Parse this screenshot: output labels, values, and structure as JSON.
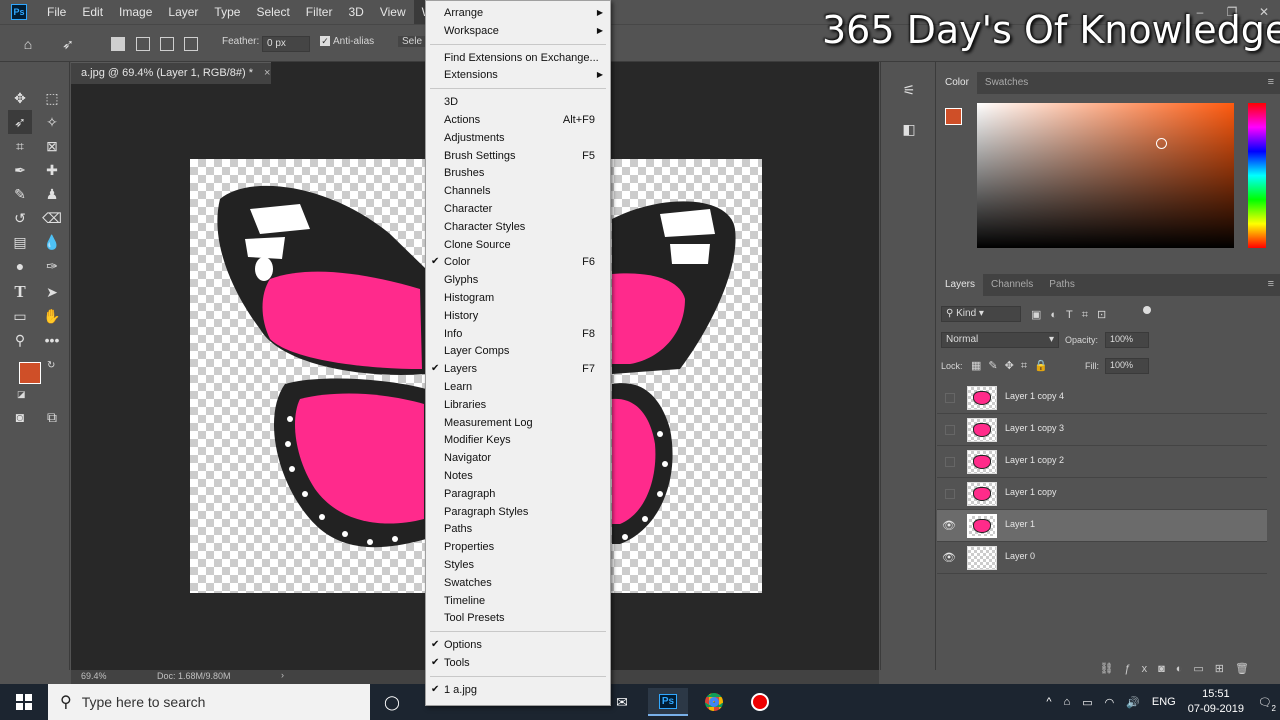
{
  "menubar": {
    "app_icon": "Ps",
    "items": [
      "File",
      "Edit",
      "Image",
      "Layer",
      "Type",
      "Select",
      "Filter",
      "3D",
      "View",
      "Window"
    ],
    "active": "Window"
  },
  "options": {
    "feather_label": "Feather:",
    "feather_value": "0 px",
    "antialias_label": "Anti-alias",
    "antialias_checked": true,
    "select_mask": "Sele"
  },
  "document": {
    "tab_title": "a.jpg @ 69.4% (Layer 1, RGB/8#) *",
    "close": "×",
    "zoom": "69.4%",
    "doc_size": "Doc: 1.68M/9.80M"
  },
  "colors": {
    "foreground": "#cf4f28",
    "background": "#ffffff"
  },
  "color_panel": {
    "tabs": [
      "Color",
      "Swatches"
    ],
    "active_tab": "Color"
  },
  "layers_panel": {
    "tabs": [
      "Layers",
      "Channels",
      "Paths"
    ],
    "active_tab": "Layers",
    "filter_kind": "Kind",
    "blend_mode": "Normal",
    "opacity_label": "Opacity:",
    "opacity": "100%",
    "lock_label": "Lock:",
    "fill_label": "Fill:",
    "fill": "100%",
    "layers": [
      {
        "name": "Layer 1 copy 4",
        "visible": false,
        "selected": false,
        "has_art": true
      },
      {
        "name": "Layer 1 copy 3",
        "visible": false,
        "selected": false,
        "has_art": true
      },
      {
        "name": "Layer 1 copy 2",
        "visible": false,
        "selected": false,
        "has_art": true
      },
      {
        "name": "Layer 1 copy",
        "visible": false,
        "selected": false,
        "has_art": true
      },
      {
        "name": "Layer 1",
        "visible": true,
        "selected": true,
        "has_art": true
      },
      {
        "name": "Layer 0",
        "visible": true,
        "selected": false,
        "has_art": false
      }
    ]
  },
  "window_menu": {
    "groups": [
      [
        {
          "label": "Arrange",
          "submenu": true
        },
        {
          "label": "Workspace",
          "submenu": true
        }
      ],
      [
        {
          "label": "Find Extensions on Exchange..."
        },
        {
          "label": "Extensions",
          "submenu": true
        }
      ],
      [
        {
          "label": "3D"
        },
        {
          "label": "Actions",
          "shortcut": "Alt+F9"
        },
        {
          "label": "Adjustments"
        },
        {
          "label": "Brush Settings",
          "shortcut": "F5"
        },
        {
          "label": "Brushes"
        },
        {
          "label": "Channels"
        },
        {
          "label": "Character"
        },
        {
          "label": "Character Styles"
        },
        {
          "label": "Clone Source"
        },
        {
          "label": "Color",
          "shortcut": "F6",
          "checked": true
        },
        {
          "label": "Glyphs"
        },
        {
          "label": "Histogram"
        },
        {
          "label": "History"
        },
        {
          "label": "Info",
          "shortcut": "F8"
        },
        {
          "label": "Layer Comps"
        },
        {
          "label": "Layers",
          "shortcut": "F7",
          "checked": true
        },
        {
          "label": "Learn"
        },
        {
          "label": "Libraries"
        },
        {
          "label": "Measurement Log"
        },
        {
          "label": "Modifier Keys"
        },
        {
          "label": "Navigator"
        },
        {
          "label": "Notes"
        },
        {
          "label": "Paragraph"
        },
        {
          "label": "Paragraph Styles"
        },
        {
          "label": "Paths"
        },
        {
          "label": "Properties"
        },
        {
          "label": "Styles"
        },
        {
          "label": "Swatches"
        },
        {
          "label": "Timeline"
        },
        {
          "label": "Tool Presets"
        }
      ],
      [
        {
          "label": "Options",
          "checked": true
        },
        {
          "label": "Tools",
          "checked": true
        }
      ],
      [
        {
          "label": "1 a.jpg",
          "checked": true
        }
      ]
    ]
  },
  "watermark": "365 Day's Of Knowledge",
  "taskbar": {
    "search_placeholder": "Type here to search",
    "language": "ENG",
    "time": "15:51",
    "date": "07-09-2019",
    "notifications": "2"
  }
}
